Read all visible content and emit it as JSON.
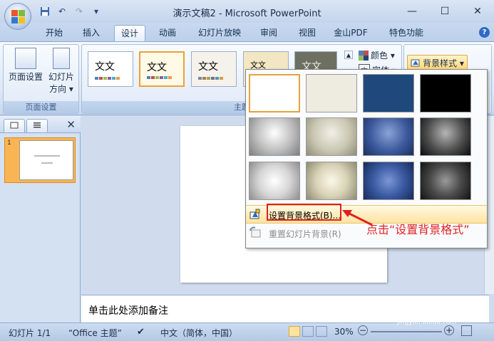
{
  "title": "演示文稿2 - Microsoft PowerPoint",
  "quick_access": {
    "save_icon": "floppy",
    "undo_icon": "undo",
    "redo_icon": "redo",
    "more": "▾"
  },
  "tabs": [
    {
      "label": "开始"
    },
    {
      "label": "插入"
    },
    {
      "label": "设计",
      "active": true
    },
    {
      "label": "动画"
    },
    {
      "label": "幻灯片放映"
    },
    {
      "label": "审阅"
    },
    {
      "label": "视图"
    },
    {
      "label": "金山PDF"
    },
    {
      "label": "特色功能"
    }
  ],
  "ribbon": {
    "page_setup_group": {
      "label": "页面设置",
      "page_setup_btn": "页面设置",
      "orientation_btn_line1": "幻灯片",
      "orientation_btn_line2": "方向 ▾"
    },
    "themes_group": {
      "label": "主题",
      "theme_text": "文文",
      "colors_btn": "颜色 ▾",
      "fonts_btn": "字体 ▾"
    },
    "background_group": {
      "bg_styles_btn": "背景样式 ▾"
    }
  },
  "slides_pane": {
    "slide_number": "1",
    "close": "✕"
  },
  "notes_placeholder": "单击此处添加备注",
  "dropdown": {
    "format_background": "设置背景格式(B)...",
    "reset_background": "重置幻灯片背景(R)"
  },
  "annotation": "点击“设置背景格式”",
  "status": {
    "slide": "幻灯片 1/1",
    "theme": "“Office 主题”",
    "language": "中文（简体，中国）",
    "zoom": "30%"
  },
  "watermark": {
    "main": "Baidu经验",
    "sub": "jingyan.baidu.com"
  }
}
